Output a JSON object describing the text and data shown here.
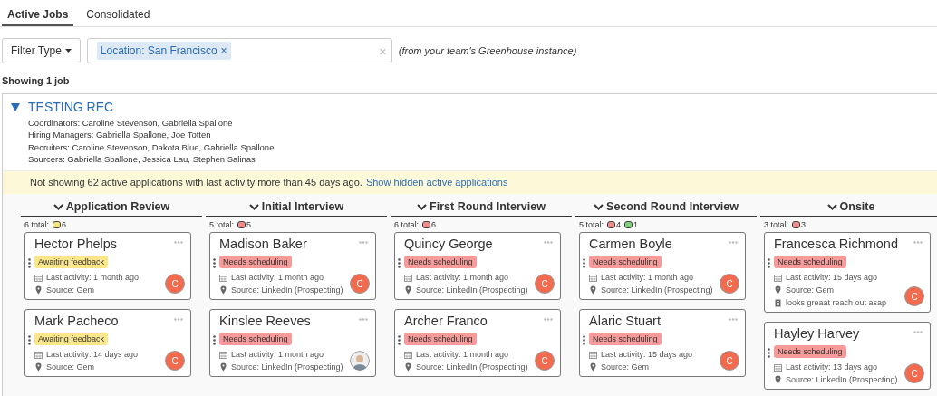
{
  "tabs": [
    {
      "label": "Active Jobs",
      "selected": true
    },
    {
      "label": "Consolidated",
      "selected": false
    }
  ],
  "filter": {
    "button": "Filter Type",
    "chips": [
      {
        "label": "Location: San Francisco",
        "remove": "×"
      }
    ],
    "clear": "×",
    "note": "(from your team's Greenhouse instance)"
  },
  "showing": "Showing 1 job",
  "job": {
    "title": "TESTING REC",
    "expanded": true,
    "details": [
      "Coordinators: Caroline Stevenson, Gabriella Spallone",
      "Hiring Managers: Gabriella Spallone, Joe Totten",
      "Recruiters: Caroline Stevenson, Dakota Blue, Gabriella Spallone",
      "Sourcers: Gabriella Spallone, Jessica Lau, Stephen Salinas"
    ],
    "banner": {
      "text": "Not showing 62 active applications with last activity more than 45 days ago.",
      "link": "Show hidden active applications"
    },
    "stages": [
      {
        "title": "Application Review",
        "total": "6 total:",
        "counts": [
          {
            "count": "6",
            "color": "#f5e27a"
          }
        ],
        "cards": [
          {
            "name": "Hector Phelps",
            "status": "Awaiting feedback",
            "color": "#fbe78a",
            "activity": "Last activity: 1 month ago",
            "source": "Source: Gem",
            "avatar": {
              "kind": "initial",
              "letter": "C"
            }
          },
          {
            "name": "Mark Pacheco",
            "status": "Awaiting feedback",
            "color": "#fbe78a",
            "activity": "Last activity: 14 days ago",
            "source": "Source: Gem",
            "avatar": {
              "kind": "initial",
              "letter": "C"
            }
          }
        ]
      },
      {
        "title": "Initial Interview",
        "total": "5 total:",
        "counts": [
          {
            "count": "5",
            "color": "#f08c8c"
          }
        ],
        "cards": [
          {
            "name": "Madison Baker",
            "status": "Needs scheduling",
            "color": "#f79a9a",
            "activity": "Last activity: 1 month ago",
            "source": "Source: LinkedIn (Prospecting)",
            "avatar": {
              "kind": "initial",
              "letter": "C"
            }
          },
          {
            "name": "Kinslee Reeves",
            "status": "Needs scheduling",
            "color": "#f79a9a",
            "activity": "Last activity: 1 month ago",
            "source": "Source: LinkedIn (Prospecting)",
            "avatar": {
              "kind": "photo"
            }
          }
        ]
      },
      {
        "title": "First Round Interview",
        "total": "6 total:",
        "counts": [
          {
            "count": "6",
            "color": "#f08c8c"
          }
        ],
        "cards": [
          {
            "name": "Quincy George",
            "status": "Needs scheduling",
            "color": "#f79a9a",
            "activity": "Last activity: 1 month ago",
            "source": "Source: LinkedIn (Prospecting)",
            "avatar": {
              "kind": "initial",
              "letter": "C"
            }
          },
          {
            "name": "Archer Franco",
            "status": "Needs scheduling",
            "color": "#f79a9a",
            "activity": "Last activity: 1 month ago",
            "source": "Source: LinkedIn (Prospecting)",
            "avatar": {
              "kind": "initial",
              "letter": "C"
            }
          }
        ]
      },
      {
        "title": "Second Round Interview",
        "total": "5 total:",
        "counts": [
          {
            "count": "4",
            "color": "#f08c8c"
          },
          {
            "count": "1",
            "color": "#7fcf7f"
          }
        ],
        "cards": [
          {
            "name": "Carmen Boyle",
            "status": "Needs scheduling",
            "color": "#f79a9a",
            "activity": "Last activity: 1 month ago",
            "source": "Source: LinkedIn (Prospecting)",
            "avatar": {
              "kind": "initial",
              "letter": "C"
            }
          },
          {
            "name": "Alaric Stuart",
            "status": "Needs scheduling",
            "color": "#f79a9a",
            "activity": "Last activity: 15 days ago",
            "source": "Source: Gem",
            "avatar": {
              "kind": "initial",
              "letter": "C"
            }
          }
        ]
      },
      {
        "title": "Onsite",
        "total": "3 total:",
        "counts": [
          {
            "count": "3",
            "color": "#f08c8c"
          }
        ],
        "cards": [
          {
            "name": "Francesca Richmond",
            "status": "Needs scheduling",
            "color": "#f79a9a",
            "activity": "Last activity: 15 days ago",
            "source": "Source: Gem",
            "note": "looks greaat reach out asap",
            "avatar": {
              "kind": "initial",
              "letter": "C"
            }
          },
          {
            "name": "Hayley Harvey",
            "status": "Needs scheduling",
            "color": "#f79a9a",
            "activity": "Last activity: 13 days ago",
            "source": "Source: LinkedIn (Prospecting)",
            "avatar": {
              "kind": "initial",
              "letter": "C"
            }
          }
        ]
      }
    ]
  }
}
